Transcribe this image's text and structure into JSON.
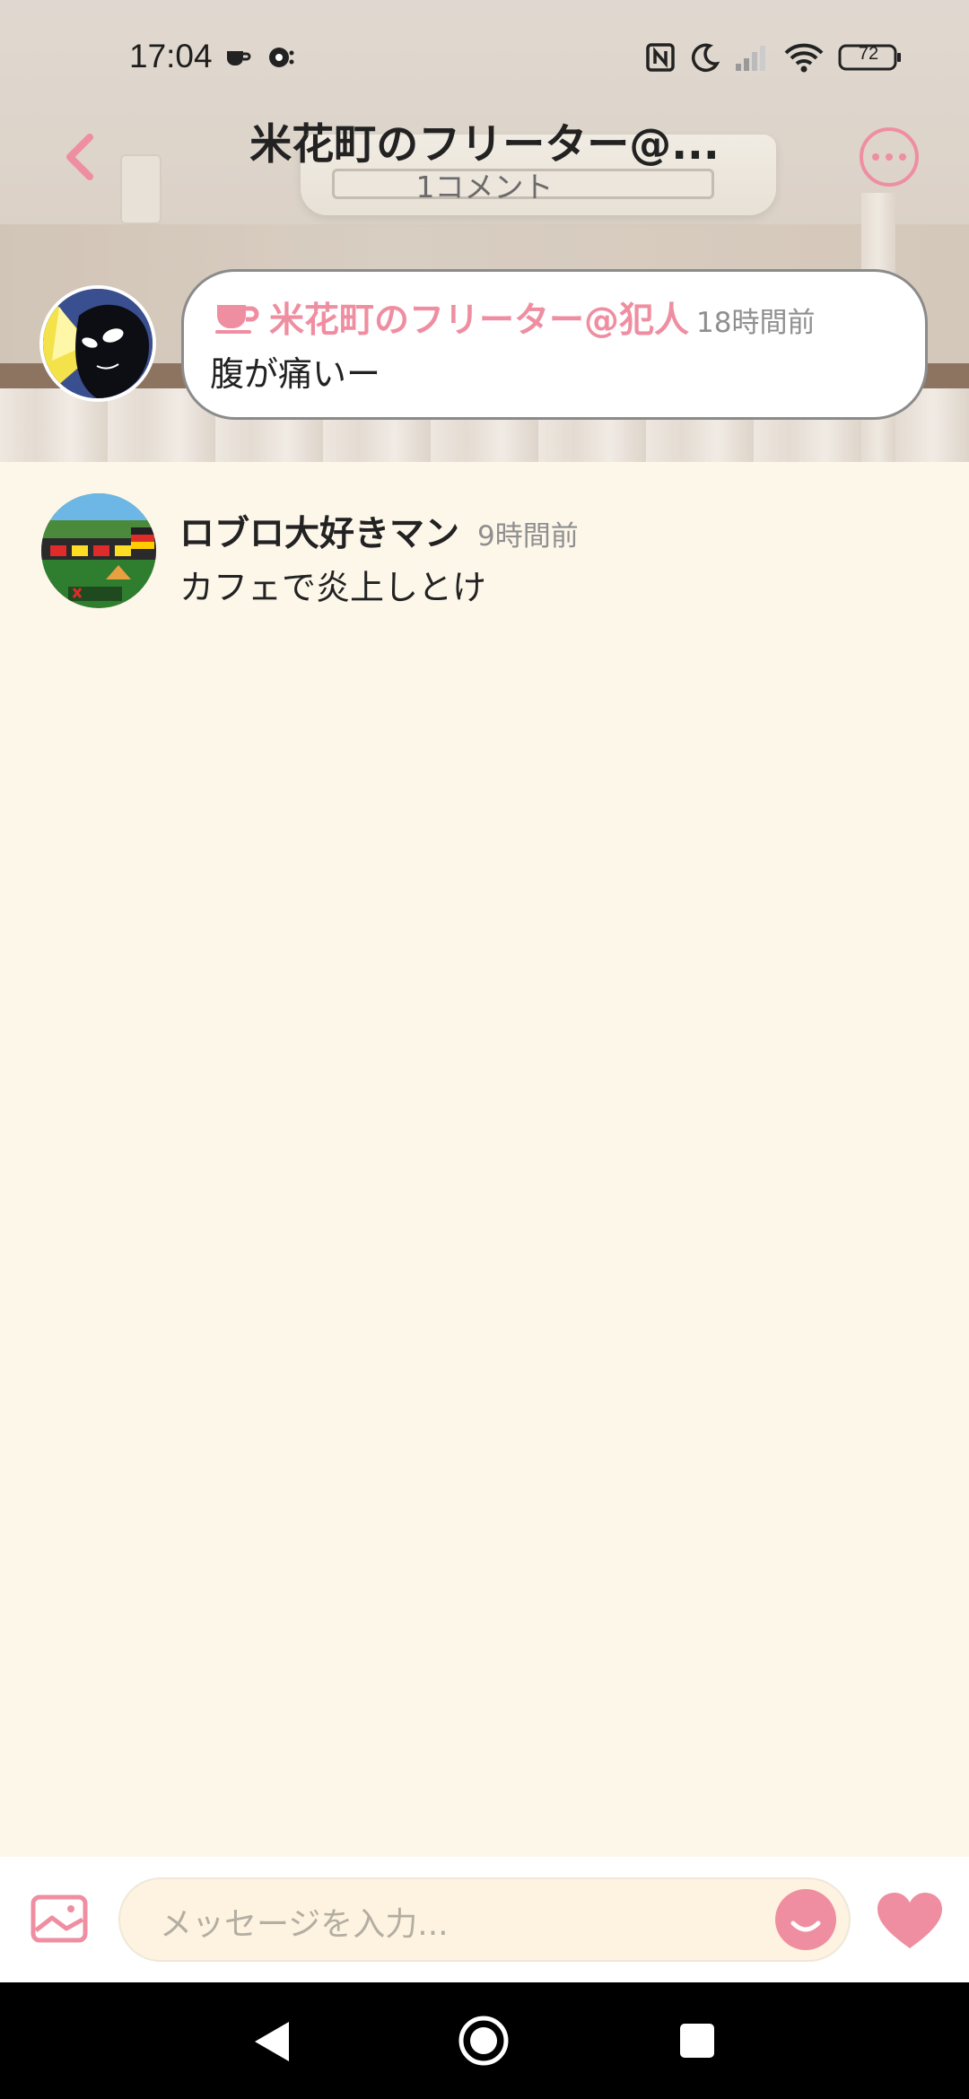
{
  "status_bar": {
    "time": "17:04",
    "battery": "72"
  },
  "header": {
    "title": "米花町のフリーター@...",
    "subtitle": "1コメント"
  },
  "post": {
    "author": "米花町のフリーター@犯人",
    "time": "18時間前",
    "text": "腹が痛いー"
  },
  "comments": [
    {
      "author": "ロブロ大好きマン",
      "time": "9時間前",
      "text": "カフェで炎上しとけ"
    }
  ],
  "input": {
    "placeholder": "メッセージを入力..."
  },
  "colors": {
    "accent": "#ef8ea1",
    "background": "#fdf7ea",
    "input_fill": "#fdf3e0"
  },
  "icons": [
    "back-arrow-icon",
    "more-icon",
    "coffee-cup-icon",
    "image-icon",
    "emoji-icon",
    "heart-icon",
    "nav-back-icon",
    "nav-home-icon",
    "nav-recents-icon"
  ]
}
